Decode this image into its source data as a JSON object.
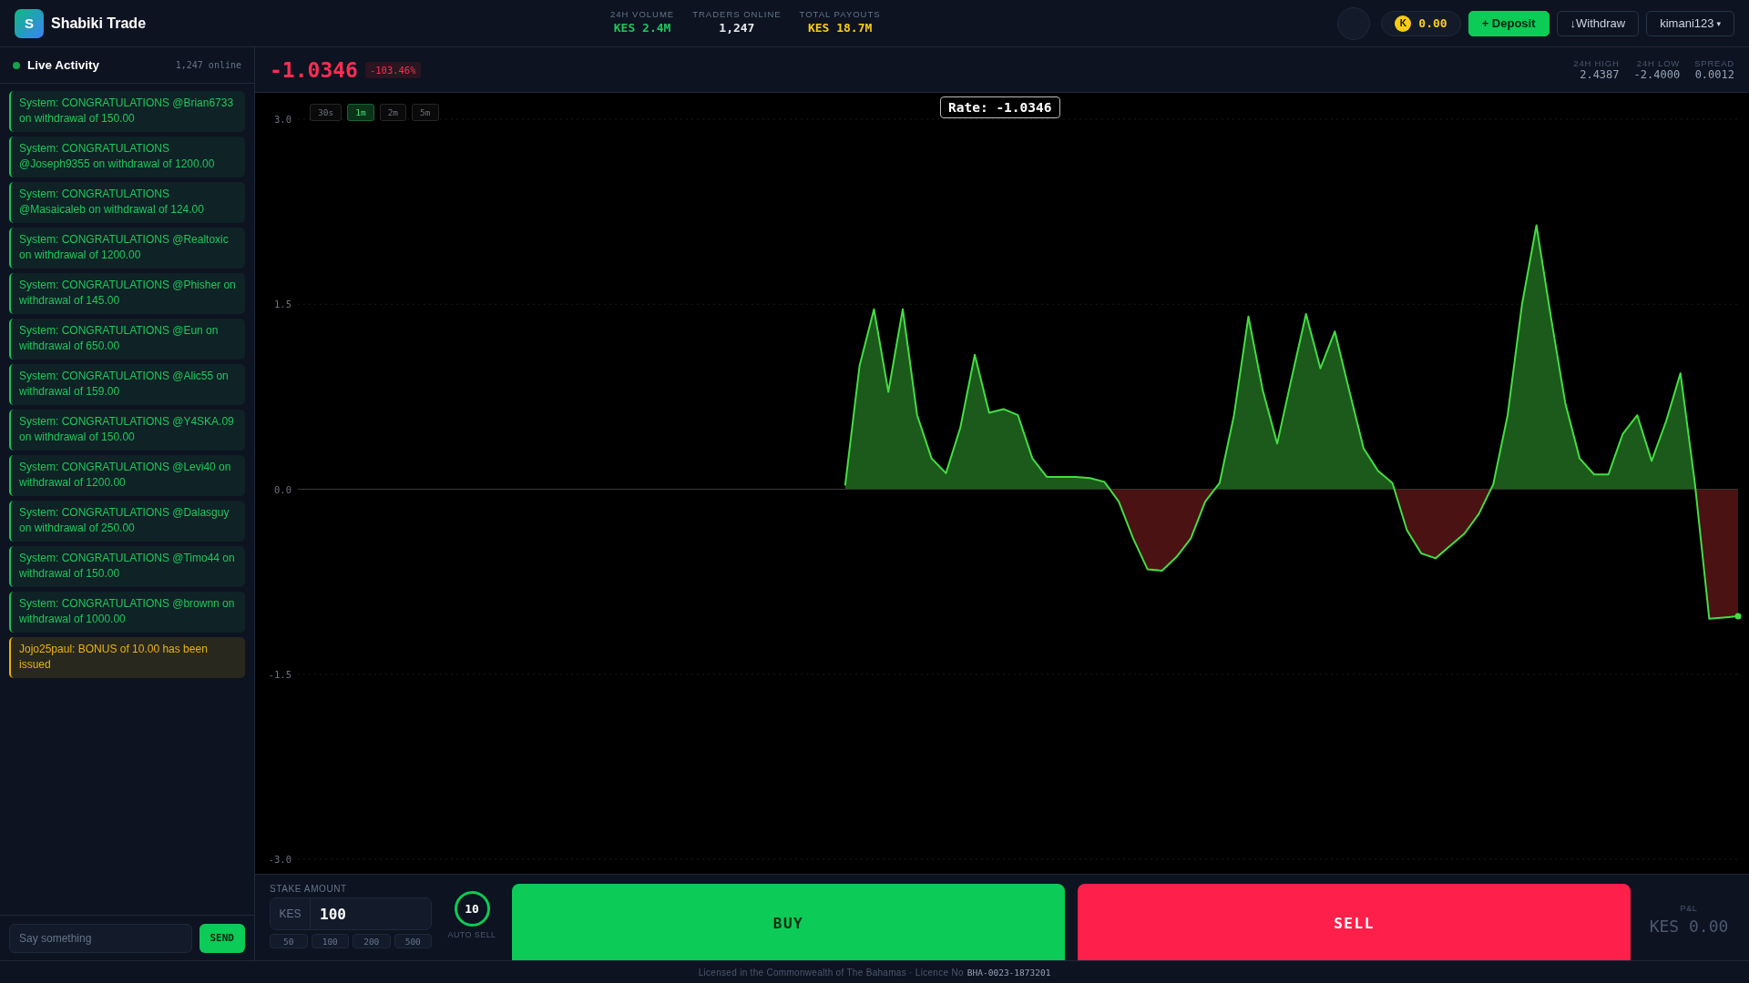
{
  "header": {
    "logo_letter": "S",
    "brand": "Shabiki Trade",
    "stats": [
      {
        "label": "24H VOLUME",
        "value": "KES 2.4M",
        "color": "#22c55e"
      },
      {
        "label": "TRADERS ONLINE",
        "value": "1,247",
        "color": "#e5e7eb"
      },
      {
        "label": "TOTAL PAYOUTS",
        "value": "KES 18.7M",
        "color": "#facc15"
      }
    ],
    "balance": {
      "coin": "K",
      "amount": "0.00"
    },
    "buttons": [
      {
        "label": "+ Deposit",
        "kind": "primary"
      },
      {
        "label": "↓Withdraw",
        "kind": "outline"
      }
    ],
    "user": {
      "name": "kimani123",
      "caret": "▾"
    }
  },
  "sidebar": {
    "title": "Live Activity",
    "online": "1,247 online",
    "messages": [
      {
        "text": "System: CONGRATULATIONS @Brian6733 on withdrawal of 150.00",
        "kind": "system"
      },
      {
        "text": "System: CONGRATULATIONS @Joseph9355 on withdrawal of 1200.00",
        "kind": "system"
      },
      {
        "text": "System: CONGRATULATIONS @Masaicaleb on withdrawal of 124.00",
        "kind": "system"
      },
      {
        "text": "System: CONGRATULATIONS @Realtoxic on withdrawal of 1200.00",
        "kind": "system"
      },
      {
        "text": "System: CONGRATULATIONS @Phisher on withdrawal of 145.00",
        "kind": "system"
      },
      {
        "text": "System: CONGRATULATIONS @Eun on withdrawal of 650.00",
        "kind": "system"
      },
      {
        "text": "System: CONGRATULATIONS @Alic55 on withdrawal of 159.00",
        "kind": "system"
      },
      {
        "text": "System: CONGRATULATIONS @Y4SKA.09 on withdrawal of 150.00",
        "kind": "system"
      },
      {
        "text": "System: CONGRATULATIONS @Levi40 on withdrawal of 1200.00",
        "kind": "system"
      },
      {
        "text": "System: CONGRATULATIONS @Dalasguy on withdrawal of 250.00",
        "kind": "system"
      },
      {
        "text": "System: CONGRATULATIONS @Timo44 on withdrawal of 150.00",
        "kind": "system"
      },
      {
        "text": "System: CONGRATULATIONS @brownn on withdrawal of 1000.00",
        "kind": "system"
      },
      {
        "text": "Jojo25paul: BONUS of 10.00 has been issued",
        "kind": "bonus"
      }
    ],
    "chat": {
      "placeholder": "Say something",
      "send": "SEND"
    }
  },
  "price": {
    "value": "-1.0346",
    "change": "-103.46%",
    "stats": [
      {
        "label": "24H HIGH",
        "value": "2.4387"
      },
      {
        "label": "24H LOW",
        "value": "-2.4000"
      },
      {
        "label": "SPREAD",
        "value": "0.0012"
      }
    ]
  },
  "chart": {
    "timeframes": [
      {
        "label": "30s",
        "selected": false
      },
      {
        "label": "1m",
        "selected": true
      },
      {
        "label": "2m",
        "selected": false
      },
      {
        "label": "5m",
        "selected": false
      }
    ],
    "rate_label": "Rate: -1.0346",
    "chart_data": {
      "type": "area",
      "ylim": [
        -3,
        3
      ],
      "categories": [
        null,
        null,
        null,
        null,
        null,
        null,
        null,
        null,
        null,
        null,
        null,
        null,
        null,
        null,
        null,
        null,
        null,
        null,
        null,
        null,
        null,
        null,
        null,
        null,
        null,
        null,
        null,
        null,
        null,
        null,
        null,
        null,
        null,
        null,
        null,
        null,
        null,
        null,
        null,
        null,
        null,
        null,
        null,
        null,
        null,
        null,
        null,
        null,
        null,
        null,
        null,
        null,
        null,
        null,
        null,
        null,
        null,
        null,
        null,
        null,
        null,
        null,
        null,
        null,
        null,
        null,
        null,
        null,
        null,
        null,
        null,
        null,
        null,
        null,
        null,
        null,
        null,
        null,
        null,
        null,
        null,
        null,
        null,
        null,
        null,
        null,
        null,
        null,
        null,
        null,
        null,
        null,
        null,
        null,
        null,
        null,
        null,
        null,
        null,
        null,
        null
      ],
      "yticks": [
        {
          "value": 3,
          "label": "3.0"
        },
        {
          "value": 1.5,
          "label": "1.5"
        },
        {
          "value": 0,
          "label": "0.0"
        },
        {
          "value": -1.5,
          "label": "-1.5"
        },
        {
          "value": -3,
          "label": "-3.0"
        }
      ],
      "series": [
        {
          "color": "#44dd44",
          "values": [
            null,
            null,
            null,
            null,
            null,
            null,
            null,
            null,
            null,
            null,
            null,
            null,
            null,
            null,
            null,
            null,
            null,
            null,
            null,
            null,
            null,
            null,
            null,
            null,
            null,
            null,
            null,
            null,
            null,
            null,
            null,
            null,
            null,
            null,
            null,
            null,
            null,
            null,
            0.03,
            1.0,
            1.46,
            0.79,
            1.46,
            0.6,
            0.25,
            0.13,
            0.5,
            1.09,
            0.62,
            0.65,
            0.6,
            0.25,
            0.1,
            0.1,
            0.1,
            0.09,
            0.06,
            -0.1,
            -0.4,
            -0.65,
            -0.66,
            -0.55,
            -0.4,
            -0.1,
            0.05,
            0.6,
            1.4,
            0.8,
            0.37,
            0.9,
            1.42,
            0.98,
            1.28,
            0.8,
            0.33,
            0.15,
            0.05,
            -0.33,
            -0.52,
            -0.56,
            -0.46,
            -0.36,
            -0.2,
            0.04,
            0.6,
            1.5,
            2.14,
            1.4,
            0.7,
            0.25,
            0.12,
            0.12,
            0.45,
            0.6,
            0.23,
            0.55,
            0.94,
            0.05,
            -1.05,
            -1.04,
            -1.03
          ]
        }
      ]
    }
  },
  "trade": {
    "stake_label": "STAKE AMOUNT",
    "currency": "KES",
    "amount": "100",
    "quick_amounts": [
      "50",
      "100",
      "200",
      "500"
    ],
    "autosell": {
      "value": "10",
      "label": "AUTO SELL"
    },
    "buy": "BUY",
    "sell": "SELL",
    "pnl": {
      "label": "P&L",
      "value": "KES 0.00"
    }
  },
  "footer": {
    "text": "Licensed in the Commonwealth of The Bahamas · Licence No",
    "licence": "BHA-0023-1873201"
  }
}
